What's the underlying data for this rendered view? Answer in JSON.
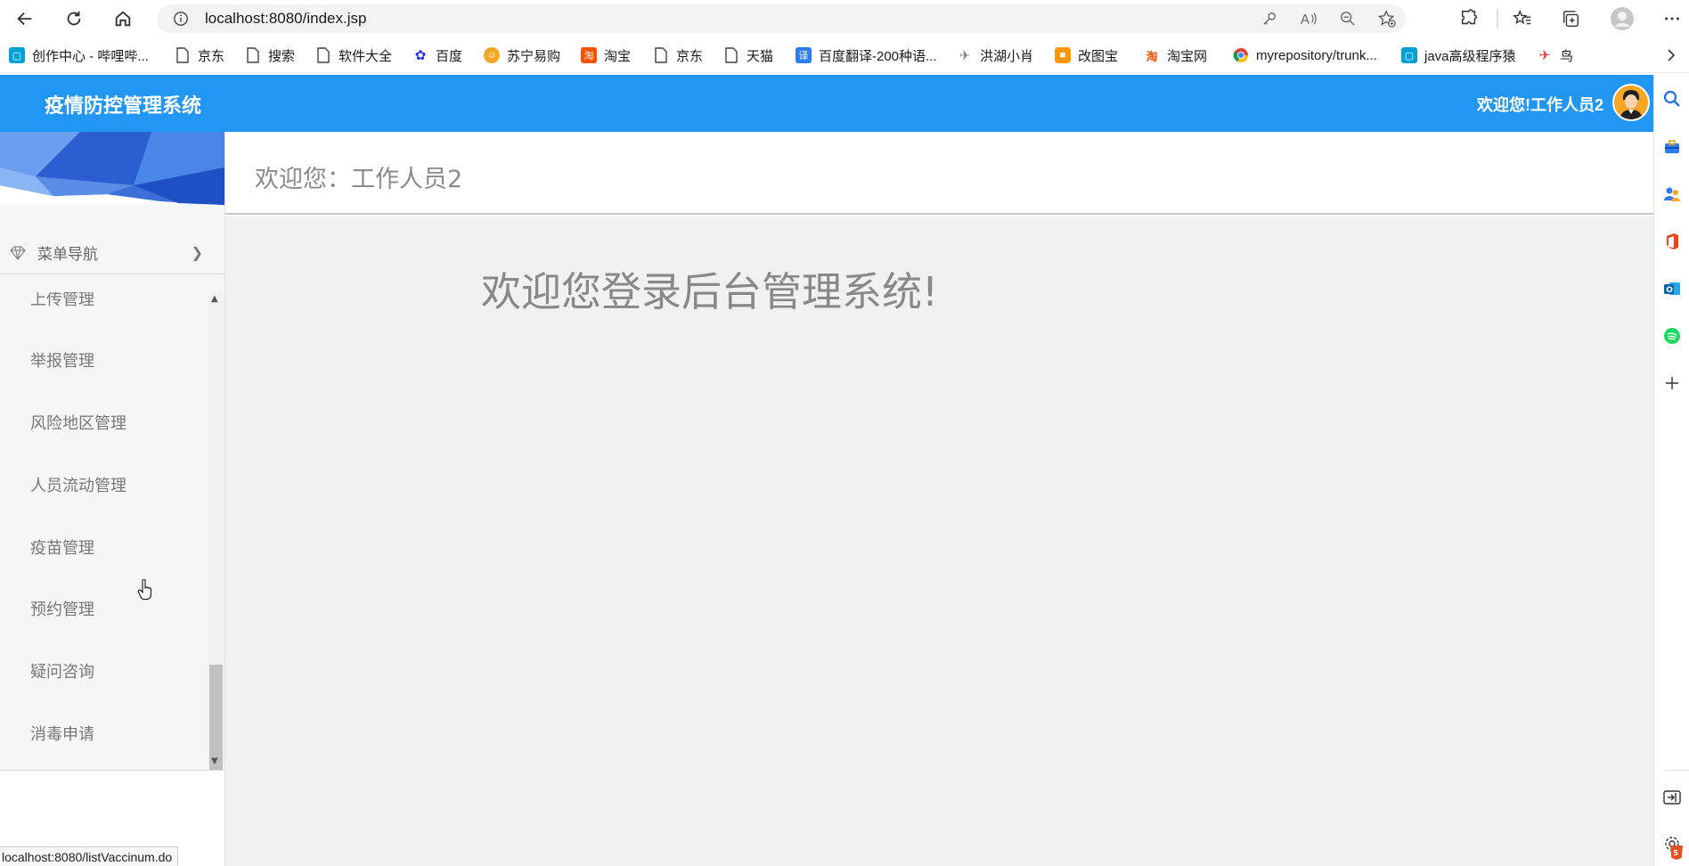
{
  "browser": {
    "url": "localhost:8080/index.jsp",
    "status_url": "localhost:8080/listVaccinum.do",
    "icons": [
      "back-icon",
      "refresh-icon",
      "home-icon",
      "info-icon",
      "key-icon",
      "read-aloud-icon",
      "zoom-icon",
      "add-favorite-icon",
      "extensions-icon",
      "favorites-icon",
      "collections-icon",
      "profile-icon",
      "more-icon"
    ]
  },
  "bookmarks": [
    {
      "label": "创作中心 - 哔哩哔...",
      "icon": "bilibili-icon",
      "color": "#00a1d6"
    },
    {
      "label": "京东",
      "icon": "page-icon",
      "color": ""
    },
    {
      "label": "搜索",
      "icon": "page-icon",
      "color": ""
    },
    {
      "label": "软件大全",
      "icon": "page-icon",
      "color": ""
    },
    {
      "label": "百度",
      "icon": "baidu-icon",
      "color": "#2932e1"
    },
    {
      "label": "苏宁易购",
      "icon": "suning-icon",
      "color": "#f5a623"
    },
    {
      "label": "淘宝",
      "icon": "taobao-icon",
      "color": "#ff5000"
    },
    {
      "label": "京东",
      "icon": "page-icon",
      "color": ""
    },
    {
      "label": "天猫",
      "icon": "page-icon",
      "color": ""
    },
    {
      "label": "百度翻译-200种语...",
      "icon": "translate-icon",
      "color": "#2d7cf6"
    },
    {
      "label": "洪湖小肖",
      "icon": "bird-icon",
      "color": "#888888"
    },
    {
      "label": "改图宝",
      "icon": "gaitubao-icon",
      "color": "#ff9800"
    },
    {
      "label": "淘宝网",
      "icon": "taobao-icon",
      "color": "#ff5000"
    },
    {
      "label": "myrepository/trunk...",
      "icon": "chrome-icon",
      "color": "#4caf50"
    },
    {
      "label": "java高级程序猿",
      "icon": "bilibili-icon",
      "color": "#00a1d6"
    },
    {
      "label": "鸟",
      "icon": "bird-icon",
      "color": "#e53935"
    }
  ],
  "app": {
    "title": "疫情防控管理系统",
    "welcome_top": "欢迎您!工作人员2",
    "greeting": "欢迎您：工作人员2",
    "big_welcome": "欢迎您登录后台管理系统!",
    "accent_color": "#2196f3"
  },
  "sidebar": {
    "nav_label": "菜单导航",
    "items": [
      "上传管理",
      "举报管理",
      "风险地区管理",
      "人员流动管理",
      "疫苗管理",
      "预约管理",
      "疑问咨询",
      "消毒申请"
    ]
  }
}
